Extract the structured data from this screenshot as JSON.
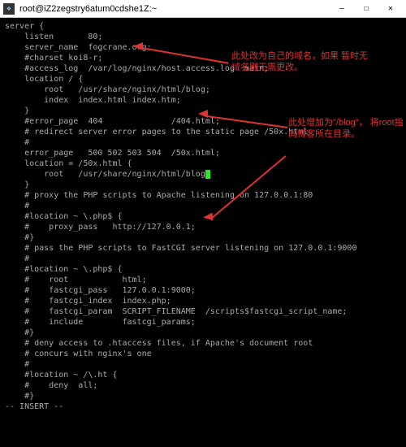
{
  "window": {
    "title": "root@iZ2zegstry6atum0cdshe1Z:~",
    "icon_glyph": "❖",
    "min": "—",
    "max": "☐",
    "close": "✕"
  },
  "config_lines": [
    "server {",
    "    listen       80;",
    "    server_name  fogcrane.org;",
    "",
    "    #charset koi8-r;",
    "    #access_log  /var/log/nginx/host.access.log  main;",
    "",
    "    location / {",
    "        root   /usr/share/nginx/html/blog;",
    "        index  index.html index.htm;",
    "    }",
    "",
    "    #error_page  404              /404.html;",
    "",
    "    # redirect server error pages to the static page /50x.html",
    "    #",
    "    error_page   500 502 503 504  /50x.html;",
    "    location = /50x.html {",
    "        root   /usr/share/nginx/html/blog",
    "    }",
    "",
    "    # proxy the PHP scripts to Apache listening on 127.0.0.1:80",
    "    #",
    "    #location ~ \\.php$ {",
    "    #    proxy_pass   http://127.0.0.1;",
    "    #}",
    "",
    "    # pass the PHP scripts to FastCGI server listening on 127.0.0.1:9000",
    "    #",
    "    #location ~ \\.php$ {",
    "    #    root           html;",
    "    #    fastcgi_pass   127.0.0.1:9000;",
    "    #    fastcgi_index  index.php;",
    "    #    fastcgi_param  SCRIPT_FILENAME  /scripts$fastcgi_script_name;",
    "    #    include        fastcgi_params;",
    "    #}",
    "",
    "    # deny access to .htaccess files, if Apache's document root",
    "    # concurs with nginx's one",
    "    #",
    "    #location ~ /\\.ht {",
    "    #    deny  all;",
    "    #}",
    "-- INSERT --"
  ],
  "cursor_line_index": 18,
  "annotations": {
    "a1": "此处改为自己的域名，如果\n暂时无域名则无需更改。",
    "a2": "此处增加为\"/blog\"，\n将root指向博客所在目录。"
  }
}
